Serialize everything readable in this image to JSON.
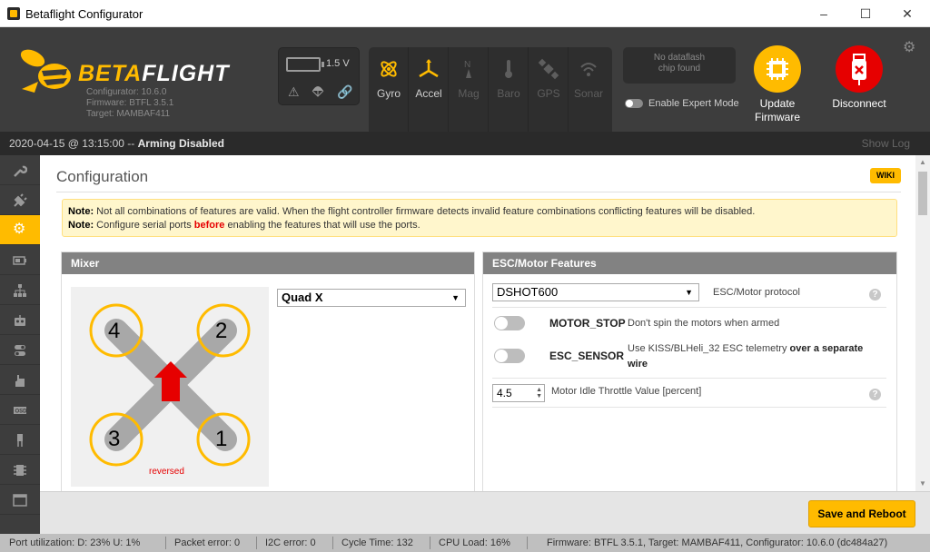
{
  "window": {
    "title": "Betaflight Configurator"
  },
  "header": {
    "logo_beta": "BETA",
    "logo_flight": "FLIGHT",
    "versions": [
      "Configurator: 10.6.0",
      "Firmware: BTFL 3.5.1",
      "Target: MAMBAF411"
    ],
    "voltage": "1.5 V",
    "sensors": [
      {
        "label": "Gyro",
        "icon": "gyro-icon",
        "active": true
      },
      {
        "label": "Accel",
        "icon": "accel-icon",
        "active": true
      },
      {
        "label": "Mag",
        "icon": "mag-icon",
        "active": false
      },
      {
        "label": "Baro",
        "icon": "baro-icon",
        "active": false
      },
      {
        "label": "GPS",
        "icon": "gps-icon",
        "active": false
      },
      {
        "label": "Sonar",
        "icon": "sonar-icon",
        "active": false
      }
    ],
    "dataflash_line1": "No dataflash",
    "dataflash_line2": "chip found",
    "expert_mode": "Enable Expert Mode",
    "update_line1": "Update",
    "update_line2": "Firmware",
    "disconnect": "Disconnect"
  },
  "status": {
    "datetime": "2020-04-15 @ 13:15:00 -- ",
    "arming": "Arming Disabled",
    "show_log": "Show Log"
  },
  "page": {
    "title": "Configuration",
    "wiki": "WIKI",
    "note1_label": "Note:",
    "note1_text": "Not all combinations of features are valid. When the flight controller firmware detects invalid feature combinations conflicting features will be disabled.",
    "note2_label": "Note:",
    "note2_pre": "Configure serial ports",
    "note2_bold": "before",
    "note2_post": "enabling the features that will use the ports."
  },
  "mixer": {
    "header": "Mixer",
    "selected": "Quad X",
    "motors": [
      "4",
      "2",
      "3",
      "1"
    ],
    "reversed_label": "reversed"
  },
  "esc": {
    "header": "ESC/Motor Features",
    "protocol_value": "DSHOT600",
    "protocol_label": "ESC/Motor protocol",
    "motor_stop_name": "MOTOR_STOP",
    "motor_stop_desc": "Don't spin the motors when armed",
    "esc_sensor_name": "ESC_SENSOR",
    "esc_sensor_desc_pre": "Use KISS/BLHeli_32 ESC telemetry",
    "esc_sensor_desc_bold": "over a separate wire",
    "idle_value": "4.5",
    "idle_label": "Motor Idle Throttle Value [percent]"
  },
  "toolbar": {
    "save_label": "Save and Reboot"
  },
  "statusbar": {
    "port": "Port utilization: D: 23% U: 1%",
    "packet": "Packet error: 0",
    "i2c": "I2C error: 0",
    "cycle": "Cycle Time: 132",
    "cpu": "CPU Load: 16%",
    "firmware": "Firmware: BTFL 3.5.1, Target: MAMBAF411, Configurator: 10.6.0 (dc484a27)"
  },
  "colors": {
    "accent": "#ffbb00",
    "disconnect": "#e60000",
    "header_bg": "#3d3d3d"
  }
}
